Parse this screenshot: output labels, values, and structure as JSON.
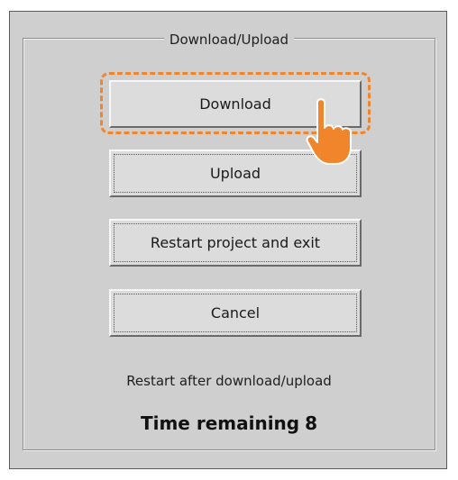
{
  "dialog": {
    "group_title": "Download/Upload",
    "buttons": {
      "download": "Download",
      "upload": "Upload",
      "restart": "Restart project and exit",
      "cancel": "Cancel"
    },
    "info_text": "Restart after download/upload",
    "timer": {
      "label": "Time remaining",
      "value": "8"
    }
  },
  "colors": {
    "highlight": "#f0852b",
    "dialog_bg": "#cfcfcf",
    "button_bg": "#dcdcdc"
  },
  "icons": {
    "pointer": "hand-pointer-icon"
  }
}
